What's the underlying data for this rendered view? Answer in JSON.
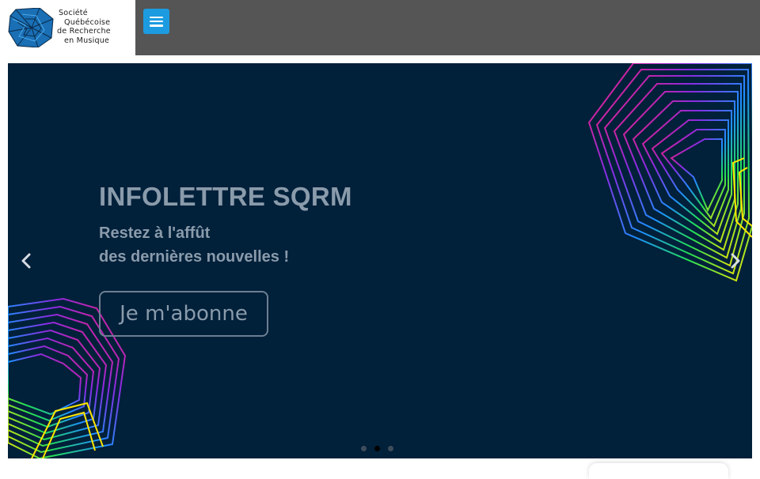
{
  "header": {
    "logo_lines": [
      "Société",
      "Québécoise",
      "de Recherche",
      "en Musique"
    ],
    "menu_icon": "hamburger-icon",
    "colors": {
      "background": "#555555",
      "menu_button": "#1c9be0"
    }
  },
  "slider": {
    "background": "#01203a",
    "slide": {
      "title": "INFOLETTRE SQRM",
      "subtitle_line1": "Restez à l'affût",
      "subtitle_line2": "des dernières nouvelles !",
      "button_label": "Je m'abonne"
    },
    "prev_icon": "chevron-left-icon",
    "next_icon": "chevron-right-icon",
    "pagination": {
      "count": 3,
      "active_index": 1
    }
  }
}
